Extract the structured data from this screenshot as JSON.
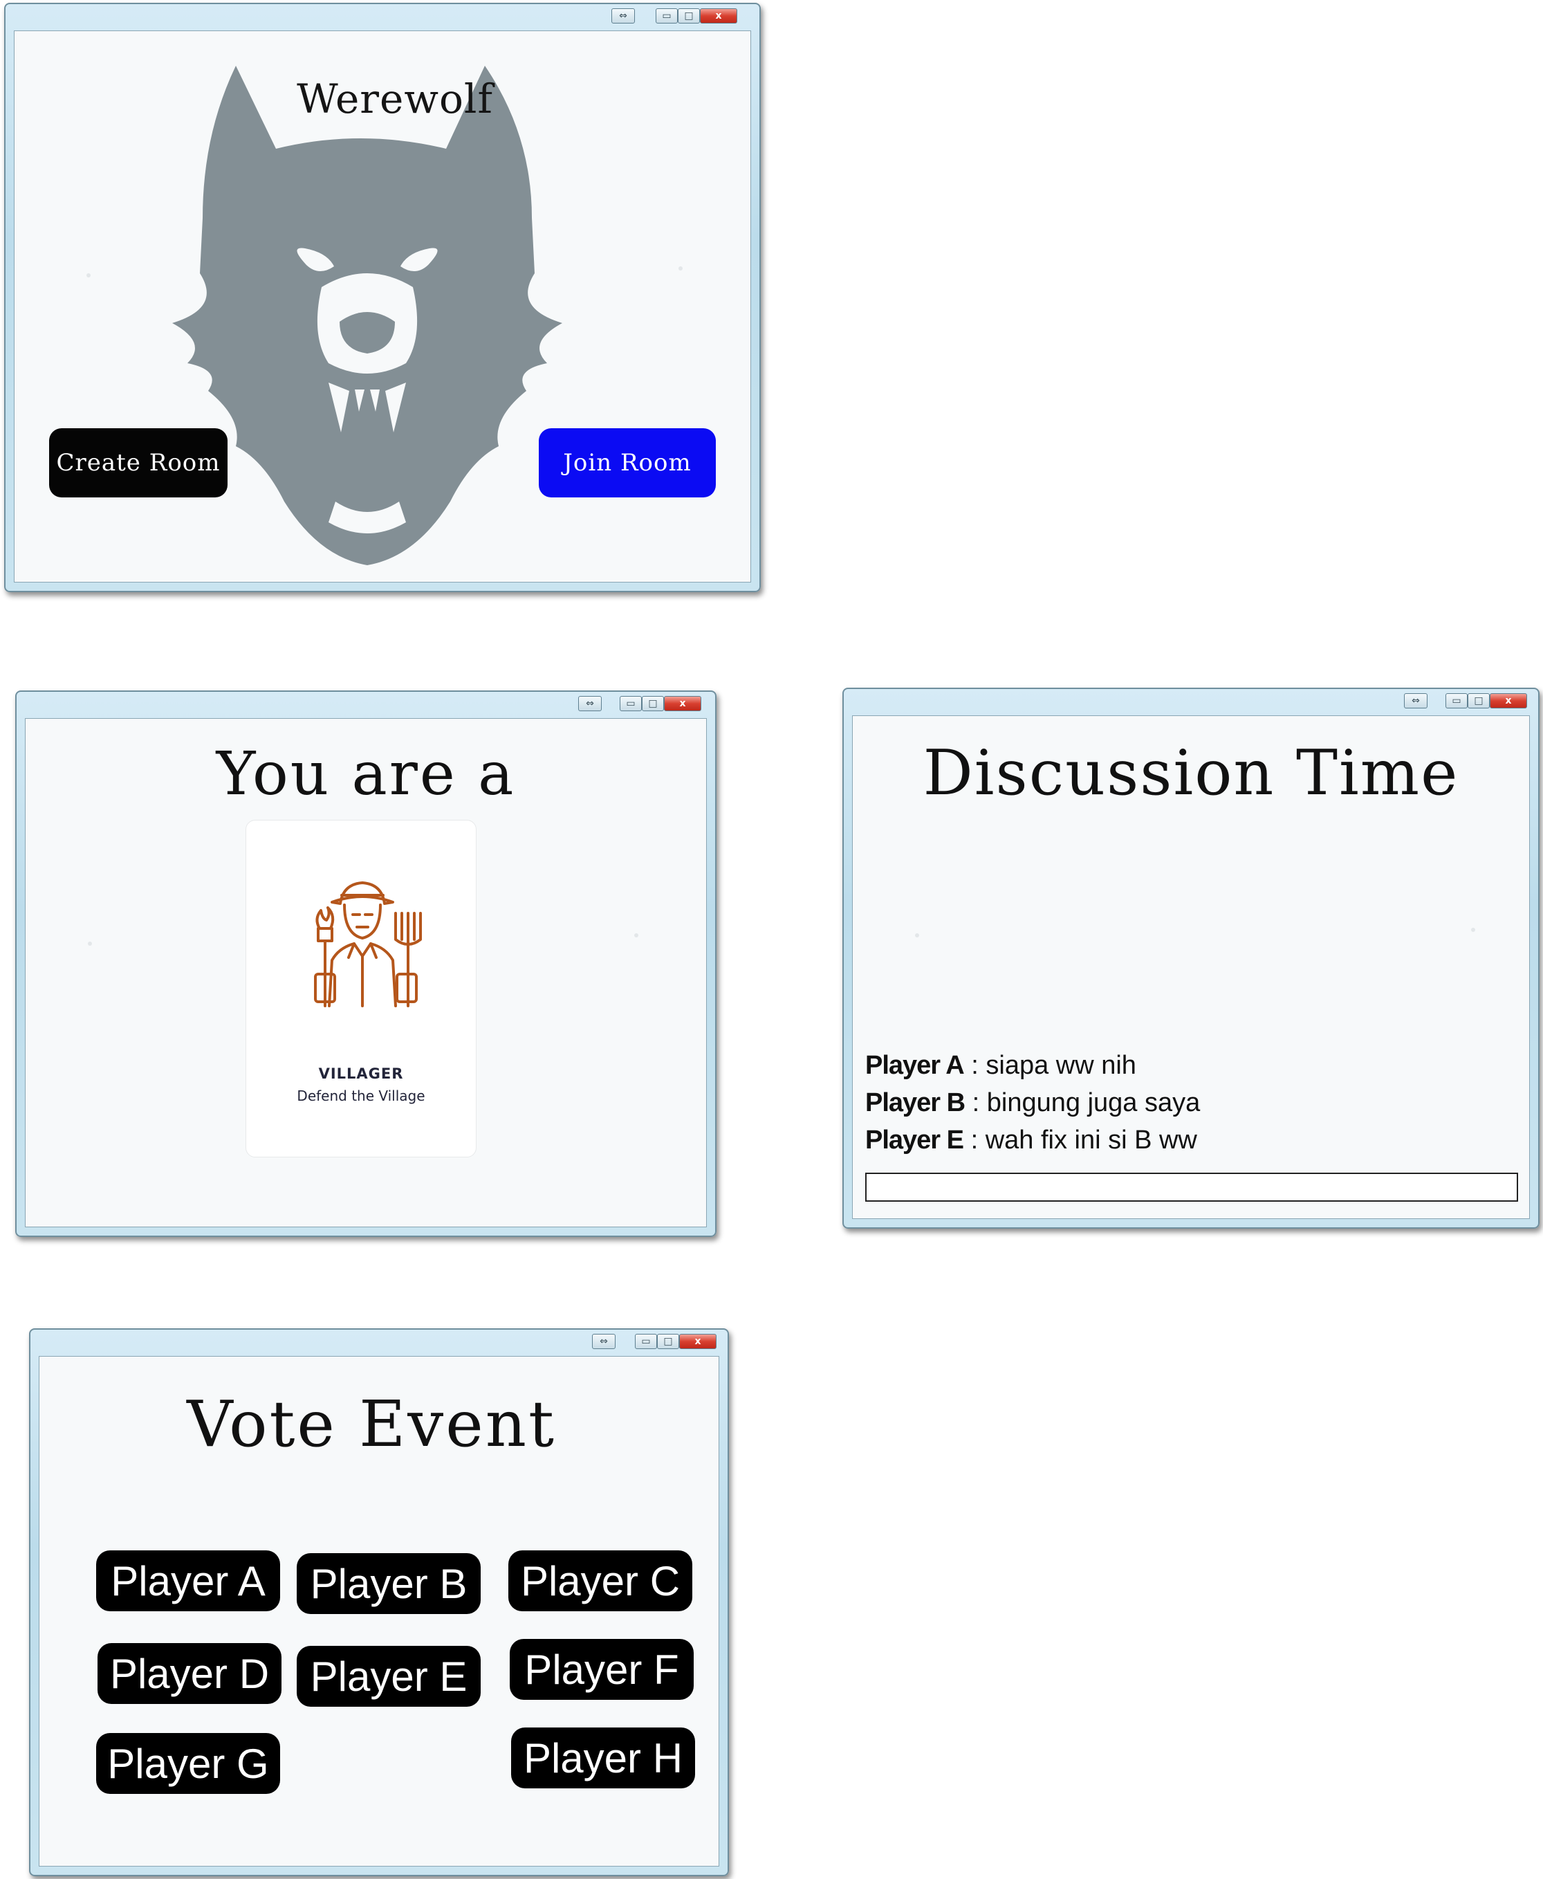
{
  "windows": {
    "controls": {
      "restore": "⇔",
      "minimize": "▭",
      "maximize": "□",
      "close": "x"
    }
  },
  "main_menu": {
    "title": "Werewolf",
    "create_room_label": "Create Room",
    "join_room_label": "Join Room"
  },
  "role_screen": {
    "title": "You are a",
    "role_name": "VILLAGER",
    "role_description": "Defend the Village",
    "role_icon": "farmer-icon"
  },
  "discussion": {
    "title": "Discussion Time",
    "messages": [
      {
        "player": "Player A",
        "text": "siapa ww nih"
      },
      {
        "player": "Player B",
        "text": "bingung juga saya"
      },
      {
        "player": "Player E",
        "text": "wah fix ini si B ww"
      }
    ],
    "input_value": ""
  },
  "vote": {
    "title": "Vote Event",
    "players": [
      "Player A",
      "Player B",
      "Player C",
      "Player D",
      "Player E",
      "Player F",
      "Player G",
      "Player H"
    ]
  },
  "colors": {
    "create_room_bg": "#050505",
    "join_room_bg": "#0b0bf3",
    "wolf": "#838f95",
    "villager_icon": "#b5561b",
    "vote_button_bg": "#000000"
  }
}
